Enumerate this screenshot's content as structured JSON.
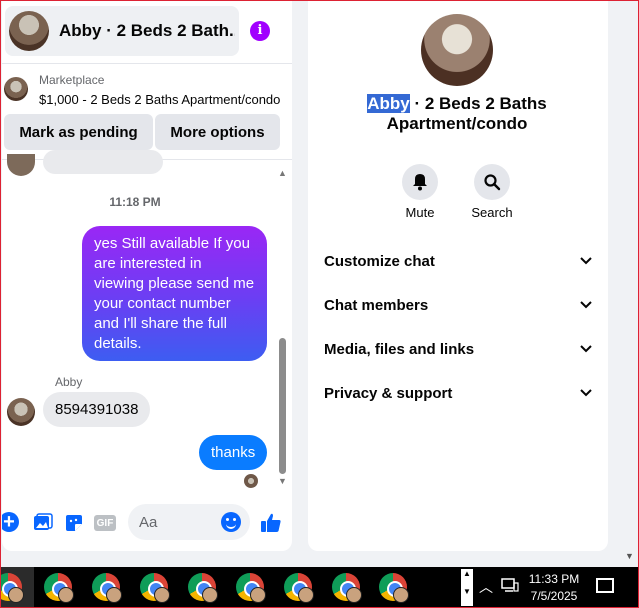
{
  "chat": {
    "header_title": "Abby · 2 Beds 2 Bath...",
    "marketplace_label": "Marketplace",
    "listing_title": "$1,000 - 2 Beds 2 Baths Apartment/condo",
    "mark_pending_label": "Mark as pending",
    "more_options_label": "More options",
    "timestamp": "11:18 PM",
    "outgoing_message_1": "yes Still available If you are interested in viewing please send me your contact number and I'll share the full details.",
    "sender_name": "Abby",
    "incoming_message": "8594391038",
    "outgoing_message_2": "thanks",
    "composer_placeholder": "Aa",
    "gif_label": "GIF",
    "icons": [
      "info-icon",
      "plus-icon",
      "gallery-icon",
      "sticker-icon",
      "gif-icon",
      "emoji-icon",
      "like-icon"
    ]
  },
  "info_panel": {
    "name_highlighted": "Abby",
    "title_rest": " · 2 Beds 2 Baths Apartment/condo",
    "mute_label": "Mute",
    "search_label": "Search",
    "sections": [
      {
        "label": "Customize chat"
      },
      {
        "label": "Chat members"
      },
      {
        "label": "Media, files and links"
      },
      {
        "label": "Privacy & support"
      }
    ]
  },
  "taskbar": {
    "time": "11:33 PM",
    "date": "7/5/2025",
    "app_count": 9
  },
  "colors": {
    "accent_blue": "#0a7cff",
    "gradient_top": "#9a27f5",
    "gradient_bottom": "#3d5df2",
    "info_purple": "#a100ff",
    "highlight": "#3469d4"
  }
}
